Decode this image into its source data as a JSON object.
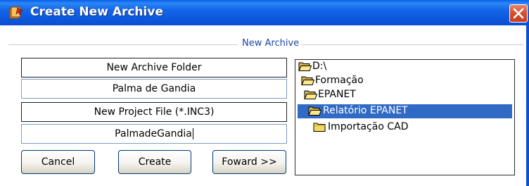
{
  "window": {
    "title": "Create New Archive"
  },
  "group": {
    "caption": "New Archive"
  },
  "fields": {
    "archive_folder_label": "New Archive Folder",
    "archive_folder_value": "Palma de Gandia",
    "project_file_label": "New Project File  (*.INC3)",
    "project_file_value": "PalmadeGandia"
  },
  "buttons": {
    "cancel": "Cancel",
    "create": "Create",
    "forward": "Foward >>"
  },
  "tree": {
    "items": [
      {
        "label": "D:\\",
        "icon": "open-folder-icon"
      },
      {
        "label": "Formação",
        "icon": "open-folder-icon"
      },
      {
        "label": "EPANET",
        "icon": "open-folder-icon"
      },
      {
        "label": "Relatório EPANET",
        "icon": "open-folder-icon",
        "selected": true
      },
      {
        "label": "Importação CAD",
        "icon": "closed-folder-icon"
      }
    ]
  },
  "colors": {
    "titlebar": "#0b55d8",
    "selection": "#316ac5",
    "group_caption": "#1a45a8",
    "close_button": "#d8512e"
  }
}
